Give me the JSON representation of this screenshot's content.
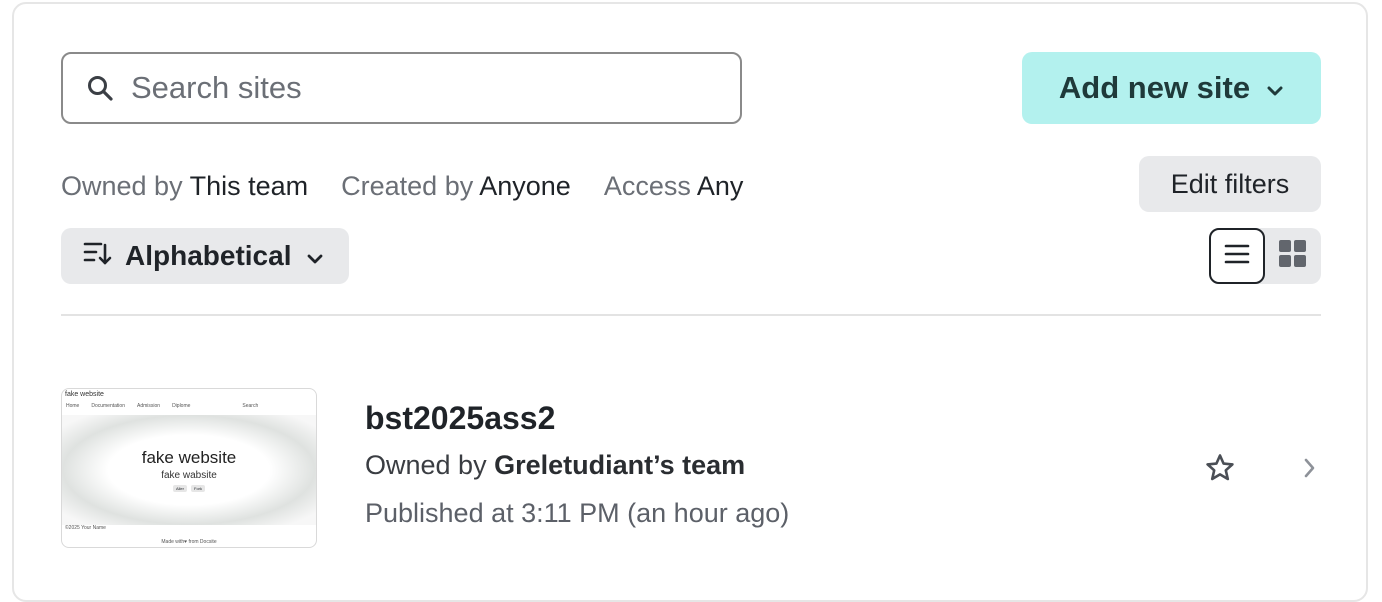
{
  "search": {
    "placeholder": "Search sites",
    "value": ""
  },
  "add_site": {
    "label": "Add new site"
  },
  "filters": [
    {
      "key": "Owned by",
      "value": "This team"
    },
    {
      "key": "Created by",
      "value": "Anyone"
    },
    {
      "key": "Access",
      "value": "Any"
    }
  ],
  "edit_filters": {
    "label": "Edit filters"
  },
  "sort": {
    "label": "Alphabetical"
  },
  "view": {
    "selected": "list"
  },
  "sites": [
    {
      "name": "bst2025ass2",
      "owner_prefix": "Owned by",
      "owner": "Greletudiant’s team",
      "published": "Published at 3:11 PM (an hour ago)",
      "thumbnail": {
        "brand": "fake website",
        "nav": [
          "Home",
          "Documentation",
          "Admission",
          "Diplome"
        ],
        "search": "Search",
        "hero_title": "fake website",
        "hero_subtitle": "fake wabsite",
        "buttons": [
          "Aller",
          "Fork"
        ],
        "footer_left": "©2025 Your Name",
        "footer_center": "Made with♥ from Docsite"
      }
    }
  ],
  "colors": {
    "accent": "#b3f1ee",
    "secondary_button": "#e8e9eb",
    "border": "#8a8a8a"
  }
}
